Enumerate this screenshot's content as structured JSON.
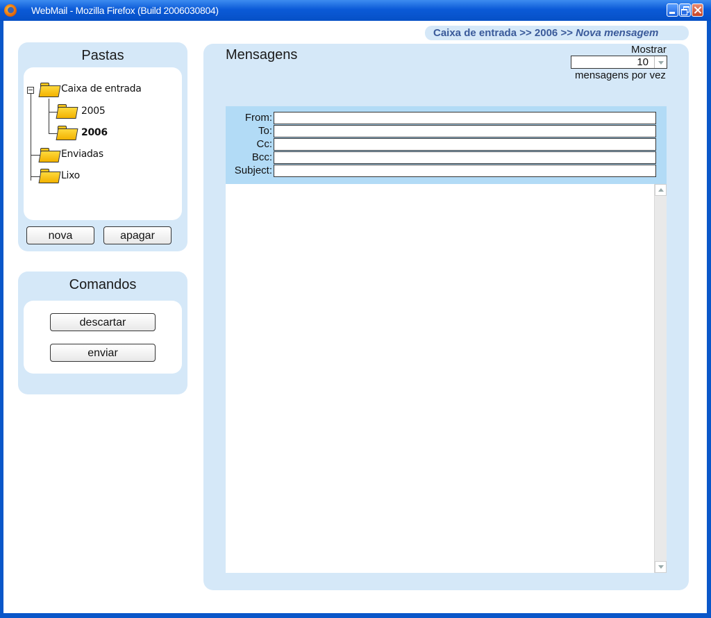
{
  "window": {
    "title": "WebMail - Mozilla Firefox (Build 2006030804)"
  },
  "breadcrumb": {
    "path": "Caixa de entrada >> 2006 >> ",
    "current": "Nova mensagem"
  },
  "pastas": {
    "title": "Pastas",
    "folders": [
      {
        "label": "Caixa de entrada"
      },
      {
        "label": "2005"
      },
      {
        "label": "2006"
      },
      {
        "label": "Enviadas"
      },
      {
        "label": "Lixo"
      }
    ],
    "selected": "2006",
    "nova_label": "nova",
    "apagar_label": "apagar"
  },
  "comandos": {
    "title": "Comandos",
    "descartar_label": "descartar",
    "enviar_label": "enviar"
  },
  "mensagens": {
    "title": "Mensagens",
    "mostrar_label": "Mostrar",
    "per_page_value": "10",
    "por_vez_label": "mensagens por vez",
    "fields": {
      "from_label": "From:",
      "to_label": "To:",
      "cc_label": "Cc:",
      "bcc_label": "Bcc:",
      "subject_label": "Subject:",
      "from_value": "",
      "to_value": "",
      "cc_value": "",
      "bcc_value": "",
      "subject_value": ""
    },
    "body_value": ""
  },
  "icons": {
    "app": "firefox-icon",
    "minimize": "minimize-icon",
    "restore": "restore-icon",
    "close": "close-icon",
    "folder": "folder-icon",
    "collapse": "collapse-toggle-icon"
  },
  "colors": {
    "titlebar": "#0b5ad7",
    "panel_bg": "#d5e8f8",
    "header_fields_bg": "#b2dbf6",
    "breadcrumb_text": "#3a5a9a",
    "folder": "#f3c21b"
  }
}
